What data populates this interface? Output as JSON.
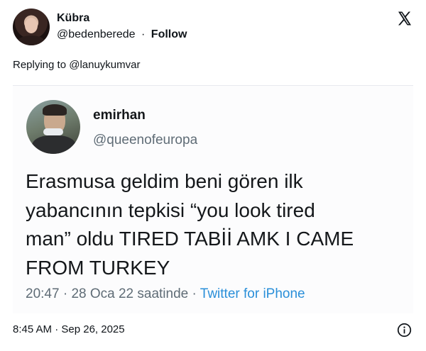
{
  "author": {
    "name": "Kübra",
    "handle": "@bedenberede",
    "separator": "·",
    "follow_label": "Follow",
    "avatar_icon": "profile-photo-avatar"
  },
  "platform_icon": "x-logo-icon",
  "reply": {
    "text": "Replying to @lanuykumvar"
  },
  "quoted_tweet": {
    "name": "emirhan",
    "handle": "@queenofeuropa",
    "avatar_icon": "profile-photo-avatar",
    "text_lines": [
      "Erasmusa geldim beni gören ilk",
      "yabancının tepkisi “you look tired",
      "man” oldu TIRED TABİİ AMK I CAME",
      "FROM TURKEY"
    ],
    "time": "20:47",
    "date": "28 Oca 22 saatinde",
    "separator": "·",
    "source": "Twitter for iPhone",
    "source_color": "#2a8fd9"
  },
  "footer": {
    "timestamp": "8:45 AM · Sep 26, 2025",
    "info_icon": "info-icon"
  }
}
